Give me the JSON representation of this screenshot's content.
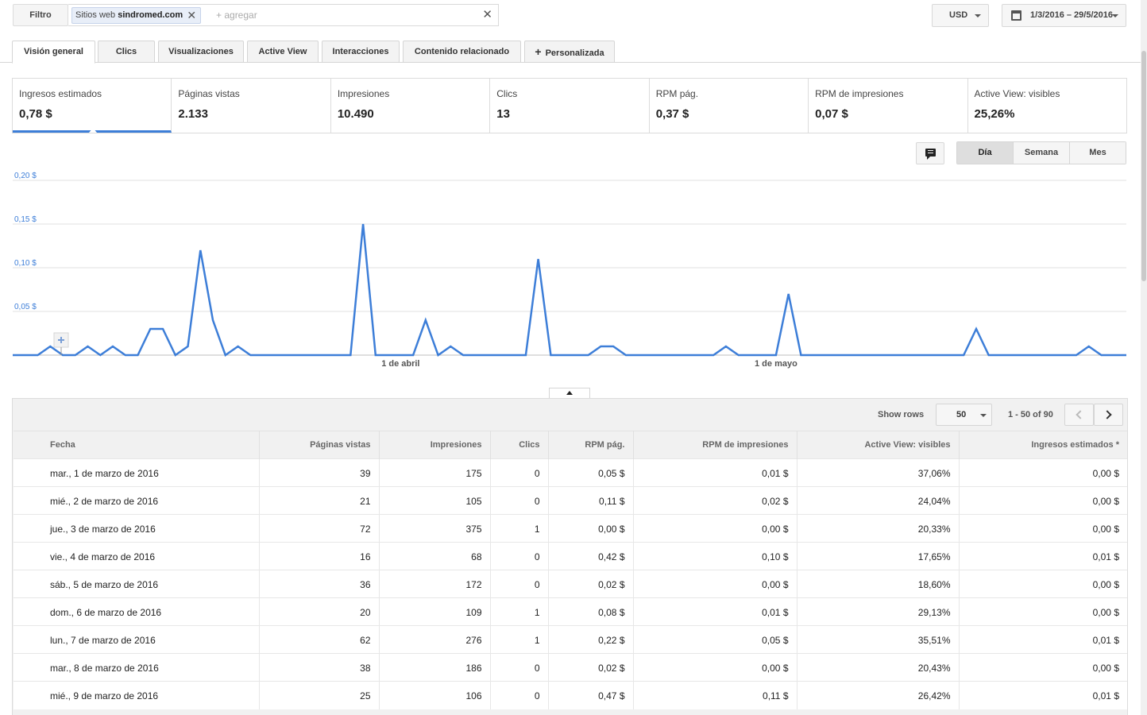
{
  "filter": {
    "button_label": "Filtro",
    "chip_prefix": "Sitios web",
    "chip_value": "sindromed.com",
    "chip_remove": "✕",
    "add_placeholder": "+ agregar",
    "clear": "✕"
  },
  "currency": {
    "selected": "USD"
  },
  "date_range": {
    "label": "1/3/2016 – 29/5/2016"
  },
  "tabs": [
    {
      "label": "Visión general",
      "active": true
    },
    {
      "label": "Clics"
    },
    {
      "label": "Visualizaciones"
    },
    {
      "label": "Active View"
    },
    {
      "label": "Interacciones"
    },
    {
      "label": "Contenido relacionado"
    },
    {
      "label": "Personalizada",
      "icon": "plus-icon"
    }
  ],
  "scorecards": [
    {
      "label": "Ingresos estimados",
      "value": "0,78 $",
      "active": true
    },
    {
      "label": "Páginas vistas",
      "value": "2.133"
    },
    {
      "label": "Impresiones",
      "value": "10.490"
    },
    {
      "label": "Clics",
      "value": "13"
    },
    {
      "label": "RPM pág.",
      "value": "0,37 $"
    },
    {
      "label": "RPM de impresiones",
      "value": "0,07 $"
    },
    {
      "label": "Active View: visibles",
      "value": "25,26%"
    }
  ],
  "granularity": [
    "Día",
    "Semana",
    "Mes"
  ],
  "granularity_selected": "Día",
  "chart_data": {
    "type": "line",
    "line_color": "#3d7ed8",
    "ylim": [
      0,
      0.2
    ],
    "y_ticks": [
      "0,20 $",
      "0,15 $",
      "0,10 $",
      "0,05 $"
    ],
    "x_tick_labels": [
      "1 de abril",
      "1 de mayo"
    ],
    "x_tick_index": [
      31,
      61
    ],
    "series": [
      {
        "values": [
          0,
          0,
          0,
          0.01,
          0,
          0,
          0.01,
          0,
          0.01,
          0,
          0,
          0.03,
          0.03,
          0,
          0.01,
          0.12,
          0.04,
          0,
          0.01,
          0,
          0,
          0,
          0,
          0,
          0,
          0,
          0,
          0,
          0.15,
          0,
          0,
          0,
          0,
          0.04,
          0,
          0.01,
          0,
          0,
          0,
          0,
          0,
          0,
          0.11,
          0,
          0,
          0,
          0,
          0.01,
          0.01,
          0,
          0,
          0,
          0,
          0,
          0,
          0,
          0,
          0.01,
          0,
          0,
          0,
          0,
          0.07,
          0,
          0,
          0,
          0,
          0,
          0,
          0,
          0,
          0,
          0,
          0,
          0,
          0,
          0,
          0.03,
          0,
          0,
          0,
          0,
          0,
          0,
          0,
          0,
          0.01,
          0,
          0,
          0
        ]
      }
    ]
  },
  "table": {
    "show_rows_label": "Show rows",
    "rows_per_page": "50",
    "page_info": "1 - 50 of 90",
    "columns": [
      "Fecha",
      "Páginas vistas",
      "Impresiones",
      "Clics",
      "RPM pág.",
      "RPM de impresiones",
      "Active View: visibles",
      "Ingresos estimados *"
    ],
    "rows": [
      [
        "mar., 1 de marzo de 2016",
        "39",
        "175",
        "0",
        "0,05 $",
        "0,01 $",
        "37,06%",
        "0,00 $"
      ],
      [
        "mié., 2 de marzo de 2016",
        "21",
        "105",
        "0",
        "0,11 $",
        "0,02 $",
        "24,04%",
        "0,00 $"
      ],
      [
        "jue., 3 de marzo de 2016",
        "72",
        "375",
        "1",
        "0,00 $",
        "0,00 $",
        "20,33%",
        "0,00 $"
      ],
      [
        "vie., 4 de marzo de 2016",
        "16",
        "68",
        "0",
        "0,42 $",
        "0,10 $",
        "17,65%",
        "0,01 $"
      ],
      [
        "sáb., 5 de marzo de 2016",
        "36",
        "172",
        "0",
        "0,02 $",
        "0,00 $",
        "18,60%",
        "0,00 $"
      ],
      [
        "dom., 6 de marzo de 2016",
        "20",
        "109",
        "1",
        "0,08 $",
        "0,01 $",
        "29,13%",
        "0,00 $"
      ],
      [
        "lun., 7 de marzo de 2016",
        "62",
        "276",
        "1",
        "0,22 $",
        "0,05 $",
        "35,51%",
        "0,01 $"
      ],
      [
        "mar., 8 de marzo de 2016",
        "38",
        "186",
        "0",
        "0,02 $",
        "0,00 $",
        "20,43%",
        "0,00 $"
      ],
      [
        "mié., 9 de marzo de 2016",
        "25",
        "106",
        "0",
        "0,47 $",
        "0,11 $",
        "26,42%",
        "0,01 $"
      ]
    ]
  }
}
